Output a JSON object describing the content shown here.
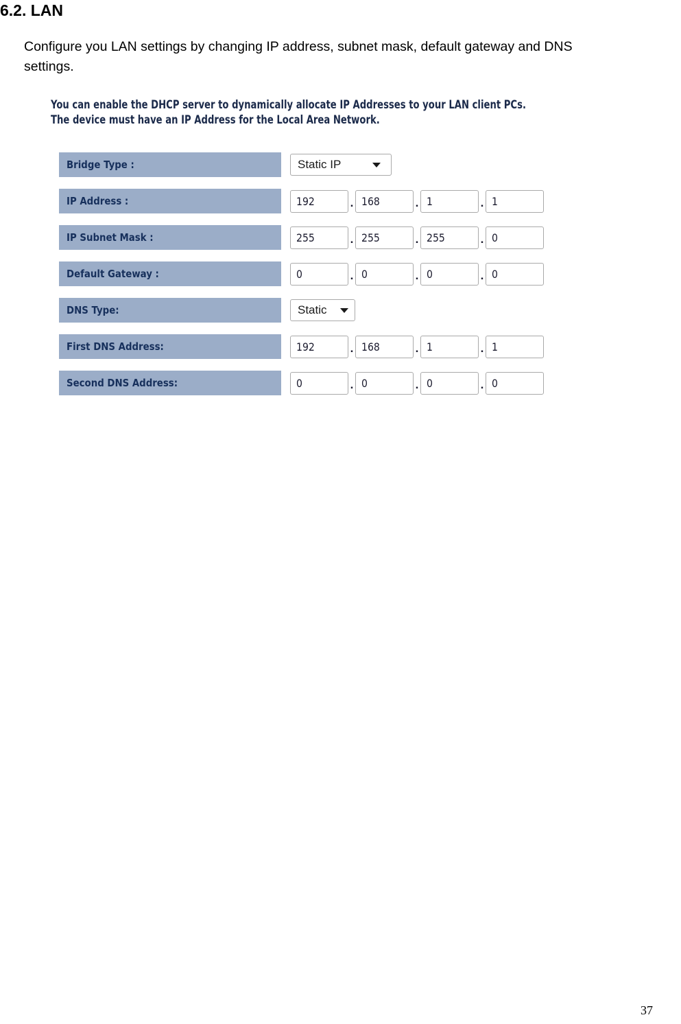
{
  "document": {
    "heading": "6.2. LAN",
    "intro": "Configure you LAN settings by changing IP address, subnet mask, default gateway and DNS settings.",
    "page_number": "37"
  },
  "ui": {
    "note_line_1": "You can enable the DHCP server to dynamically allocate IP Addresses to your LAN client PCs.",
    "note_line_2": "The device must have an IP Address for the Local Area Network.",
    "colors": {
      "label_background": "#9badc8",
      "label_text": "#17305c",
      "field_border": "#a9a9a9",
      "field_background": "#ffffff",
      "value_text": "#1b1b2e"
    },
    "rows": [
      {
        "label": "Bridge Type :",
        "control": "select",
        "value": "Static IP"
      },
      {
        "label": "IP Address :",
        "control": "octets",
        "octets": [
          "192",
          "168",
          "1",
          "1"
        ]
      },
      {
        "label": "IP Subnet Mask :",
        "control": "octets",
        "octets": [
          "255",
          "255",
          "255",
          "0"
        ]
      },
      {
        "label": "Default Gateway :",
        "control": "octets",
        "octets": [
          "0",
          "0",
          "0",
          "0"
        ]
      },
      {
        "label": "DNS Type:",
        "control": "select",
        "value": "Static"
      },
      {
        "label": "First DNS Address:",
        "control": "octets",
        "octets": [
          "192",
          "168",
          "1",
          "1"
        ]
      },
      {
        "label": "Second DNS Address:",
        "control": "octets",
        "octets": [
          "0",
          "0",
          "0",
          "0"
        ]
      }
    ],
    "separator": "."
  }
}
